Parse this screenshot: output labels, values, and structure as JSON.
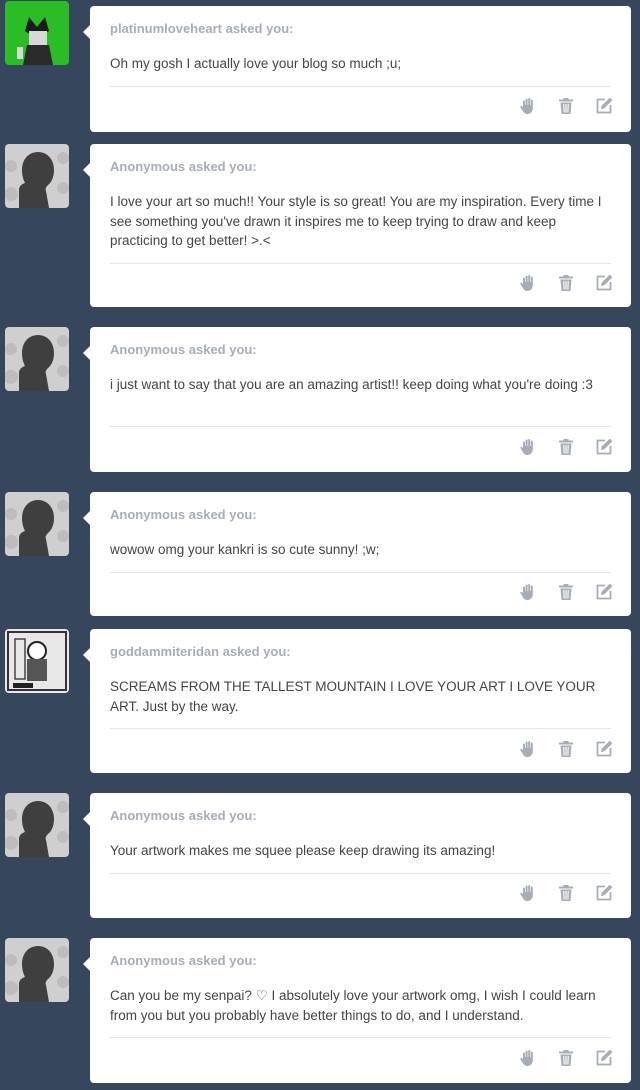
{
  "asks": [
    {
      "asker": "platinumloveheart",
      "avatar": "green-character-avatar",
      "question": "Oh my gosh I actually love your blog so much ;u;"
    },
    {
      "asker": "Anonymous",
      "avatar": "anonymous-silhouette-avatar",
      "question": "I love your art so much!! Your style is so great! You are my inspiration. Every time I see something you've drawn it inspires me to keep trying to draw and keep practicing to get better! >.<"
    },
    {
      "asker": "Anonymous",
      "avatar": "anonymous-silhouette-avatar",
      "question": "i just want to say that you are an amazing artist!! keep doing what you're doing :3"
    },
    {
      "asker": "Anonymous",
      "avatar": "anonymous-silhouette-avatar",
      "question": "wowow omg your kankri is so cute sunny! ;w;"
    },
    {
      "asker": "goddammiteridan",
      "avatar": "sketch-character-avatar",
      "question": "SCREAMS FROM THE TALLEST MOUNTAIN I LOVE YOUR ART I LOVE YOUR ART. Just by the way."
    },
    {
      "asker": "Anonymous",
      "avatar": "anonymous-silhouette-avatar",
      "question": "Your artwork makes me squee please keep drawing its amazing!"
    },
    {
      "asker": "Anonymous",
      "avatar": "anonymous-silhouette-avatar",
      "question": "Can you be my senpai? ♡ I absolutely love your artwork omg, I wish I could learn from you but you probably have better things to do, and I understand."
    }
  ],
  "asked_suffix": "asked you:",
  "action_icons": [
    "hand-block-icon",
    "trash-icon",
    "edit-icon"
  ],
  "colors": {
    "background": "#36465d",
    "card": "#ffffff",
    "asker": "#a7adb6",
    "text": "#444444",
    "icon": "#a7adb6"
  }
}
